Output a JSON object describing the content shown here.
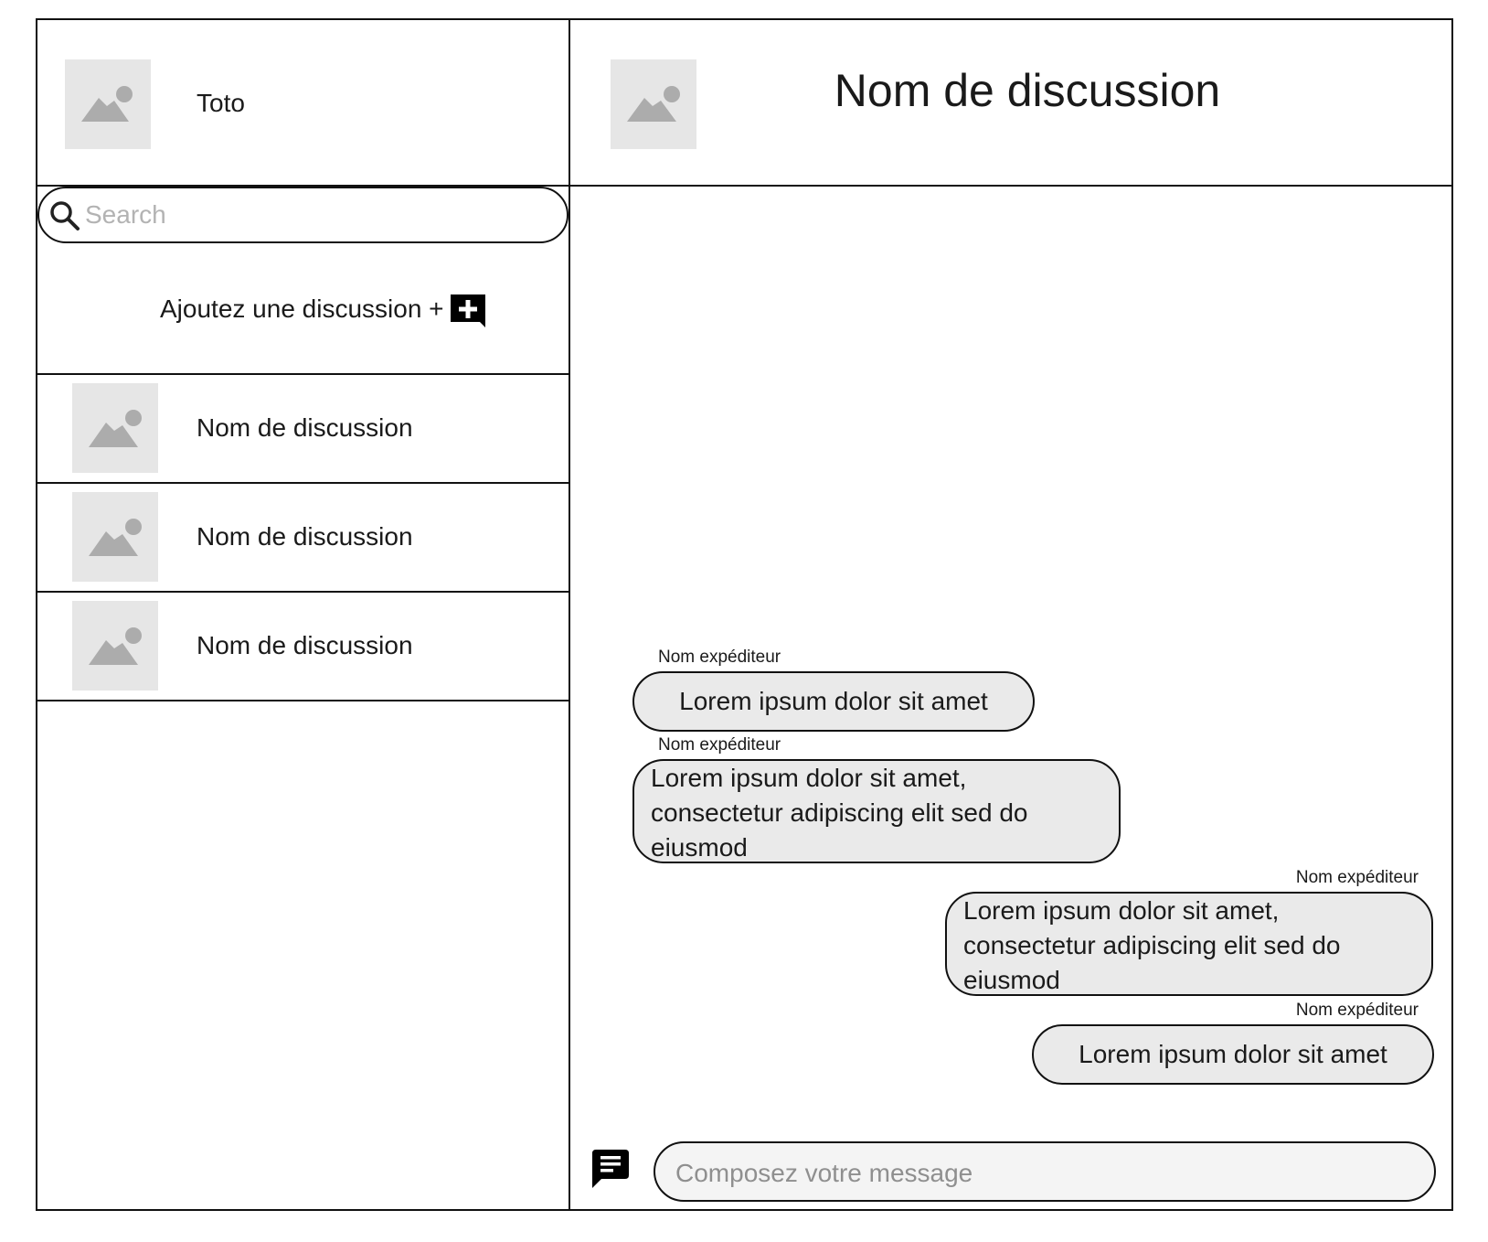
{
  "profile": {
    "name": "Toto",
    "avatar_icon": "image-placeholder-icon"
  },
  "search": {
    "placeholder": "Search",
    "value": "",
    "icon": "search-icon"
  },
  "add_discussion": {
    "label": "Ajoutez une discussion +",
    "icon": "add-chat-icon"
  },
  "conversations": [
    {
      "name": "Nom de discussion"
    },
    {
      "name": "Nom de discussion"
    },
    {
      "name": "Nom de discussion"
    }
  ],
  "chat": {
    "title": "Nom de discussion",
    "messages": [
      {
        "sender": "Nom expéditeur",
        "text": "Lorem ipsum dolor sit amet",
        "side": "left"
      },
      {
        "sender": "Nom expéditeur",
        "text": "Lorem ipsum dolor sit amet, consectetur adipiscing elit sed do eiusmod",
        "side": "left"
      },
      {
        "sender": "Nom expéditeur",
        "text": "Lorem ipsum dolor sit amet, consectetur adipiscing elit sed do eiusmod",
        "side": "right"
      },
      {
        "sender": "Nom expéditeur",
        "text": "Lorem ipsum dolor sit amet",
        "side": "right"
      }
    ]
  },
  "composer": {
    "placeholder": "Composez votre message",
    "value": "",
    "icon": "message-icon"
  },
  "colors": {
    "border": "#111111",
    "placeholder_fill": "#e6e6e6",
    "placeholder_glyph": "#acacac",
    "bubble_fill": "#eaeaea"
  }
}
